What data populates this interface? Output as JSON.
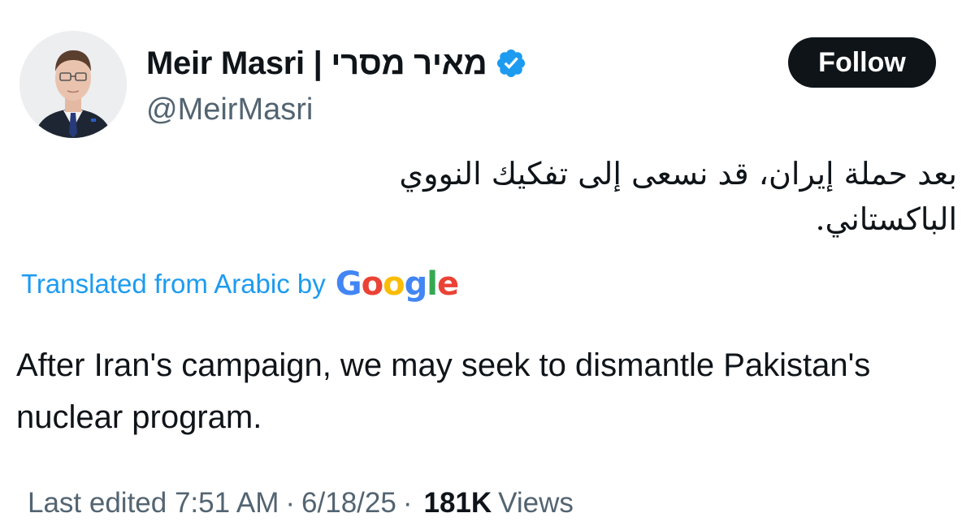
{
  "author": {
    "display_name": "Meir Masri | מאיר מסרי",
    "handle": "@MeirMasri",
    "verified_icon": "verified-badge-icon",
    "verified_color": "#1d9bf0"
  },
  "follow_label": "Follow",
  "tweet": {
    "original_text": "بعد حملة إيران، قد نسعى إلى تفكيك النووي الباكستاني.",
    "translated_label": "Translated from Arabic by",
    "translation_provider": {
      "g1": "G",
      "o1": "o",
      "o2": "o",
      "g2": "g",
      "l": "l",
      "e": "e"
    },
    "translated_text": "After Iran's campaign, we may seek to dismantle Pakistan's nuclear program."
  },
  "meta": {
    "edited": "Last edited 7:51 AM",
    "dot": "·",
    "date": "6/18/25",
    "views_count": "181K",
    "views_label": "Views"
  },
  "colors": {
    "accent": "#1d9bf0",
    "text": "#0f1419",
    "secondary": "#536471",
    "button_bg": "#0f1419"
  }
}
